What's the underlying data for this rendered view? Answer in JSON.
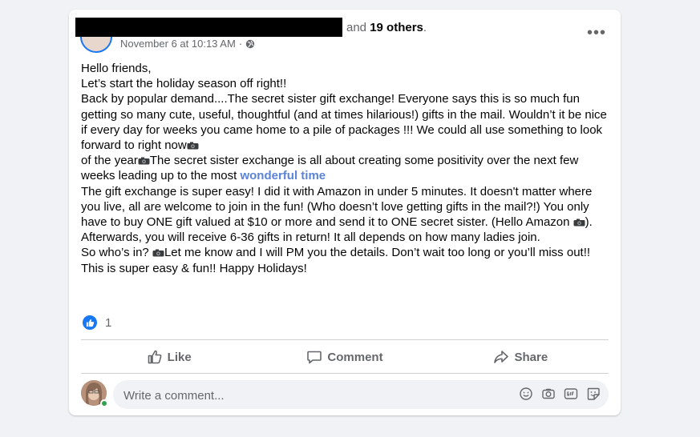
{
  "post": {
    "names_tail_and": "and",
    "names_tail_others": "19 others",
    "names_tail_period": ".",
    "timestamp": "November 6 at 10:13 AM",
    "meta_separator": "·",
    "more_label": "•••",
    "lines": {
      "l1": "Hello friends,",
      "l2": "Let’s start the holiday season off right!!",
      "l3": "Back by popular demand....The secret sister gift exchange! Everyone says this is so much fun getting so many cute, useful, thoughtful  (and at times hilarious!) gifts in the mail.  Wouldn’t it be nice if every day for weeks you came home to a pile of packages !!! We could all use something to look forward to right now",
      "l4a": "of the year",
      "l4b": "The secret sister exchange is all about creating some positivity over the next few weeks leading up to the most ",
      "l4_link": "wonderful time",
      "l5": "The gift exchange is super easy! I did it with Amazon in under 5 minutes. It doesn't matter where you live, all are welcome to join in the fun!  (Who doesn’t love getting gifts in the mail?!) You only have to buy ONE gift valued at $10 or more and send it to ONE secret sister. (Hello Amazon ",
      "l5b": ").  Afterwards, you will receive 6-36 gifts in return! It all depends on how many ladies join.",
      "l6a": "So who’s in? ",
      "l6b": "Let me know and I will PM you the details. Don’t wait too long or you’ll miss out!!",
      "l7": "This is super easy & fun!!  Happy Holidays!"
    },
    "reaction_count": "1"
  },
  "actions": {
    "like": "Like",
    "comment": "Comment",
    "share": "Share"
  },
  "comment": {
    "placeholder": "Write a comment..."
  },
  "icons": {
    "globe": "globe-icon",
    "camera": "camera-emoji-icon",
    "like": "thumbs-up-icon",
    "comment": "speech-bubble-icon",
    "share": "share-arrow-icon",
    "emoji": "smiley-icon",
    "photo": "camera-icon",
    "gif": "gif-icon",
    "sticker": "sticker-icon"
  },
  "colors": {
    "brand": "#1877f2",
    "link": "#5b84d9",
    "muted": "#65676b",
    "online": "#31a24c"
  }
}
